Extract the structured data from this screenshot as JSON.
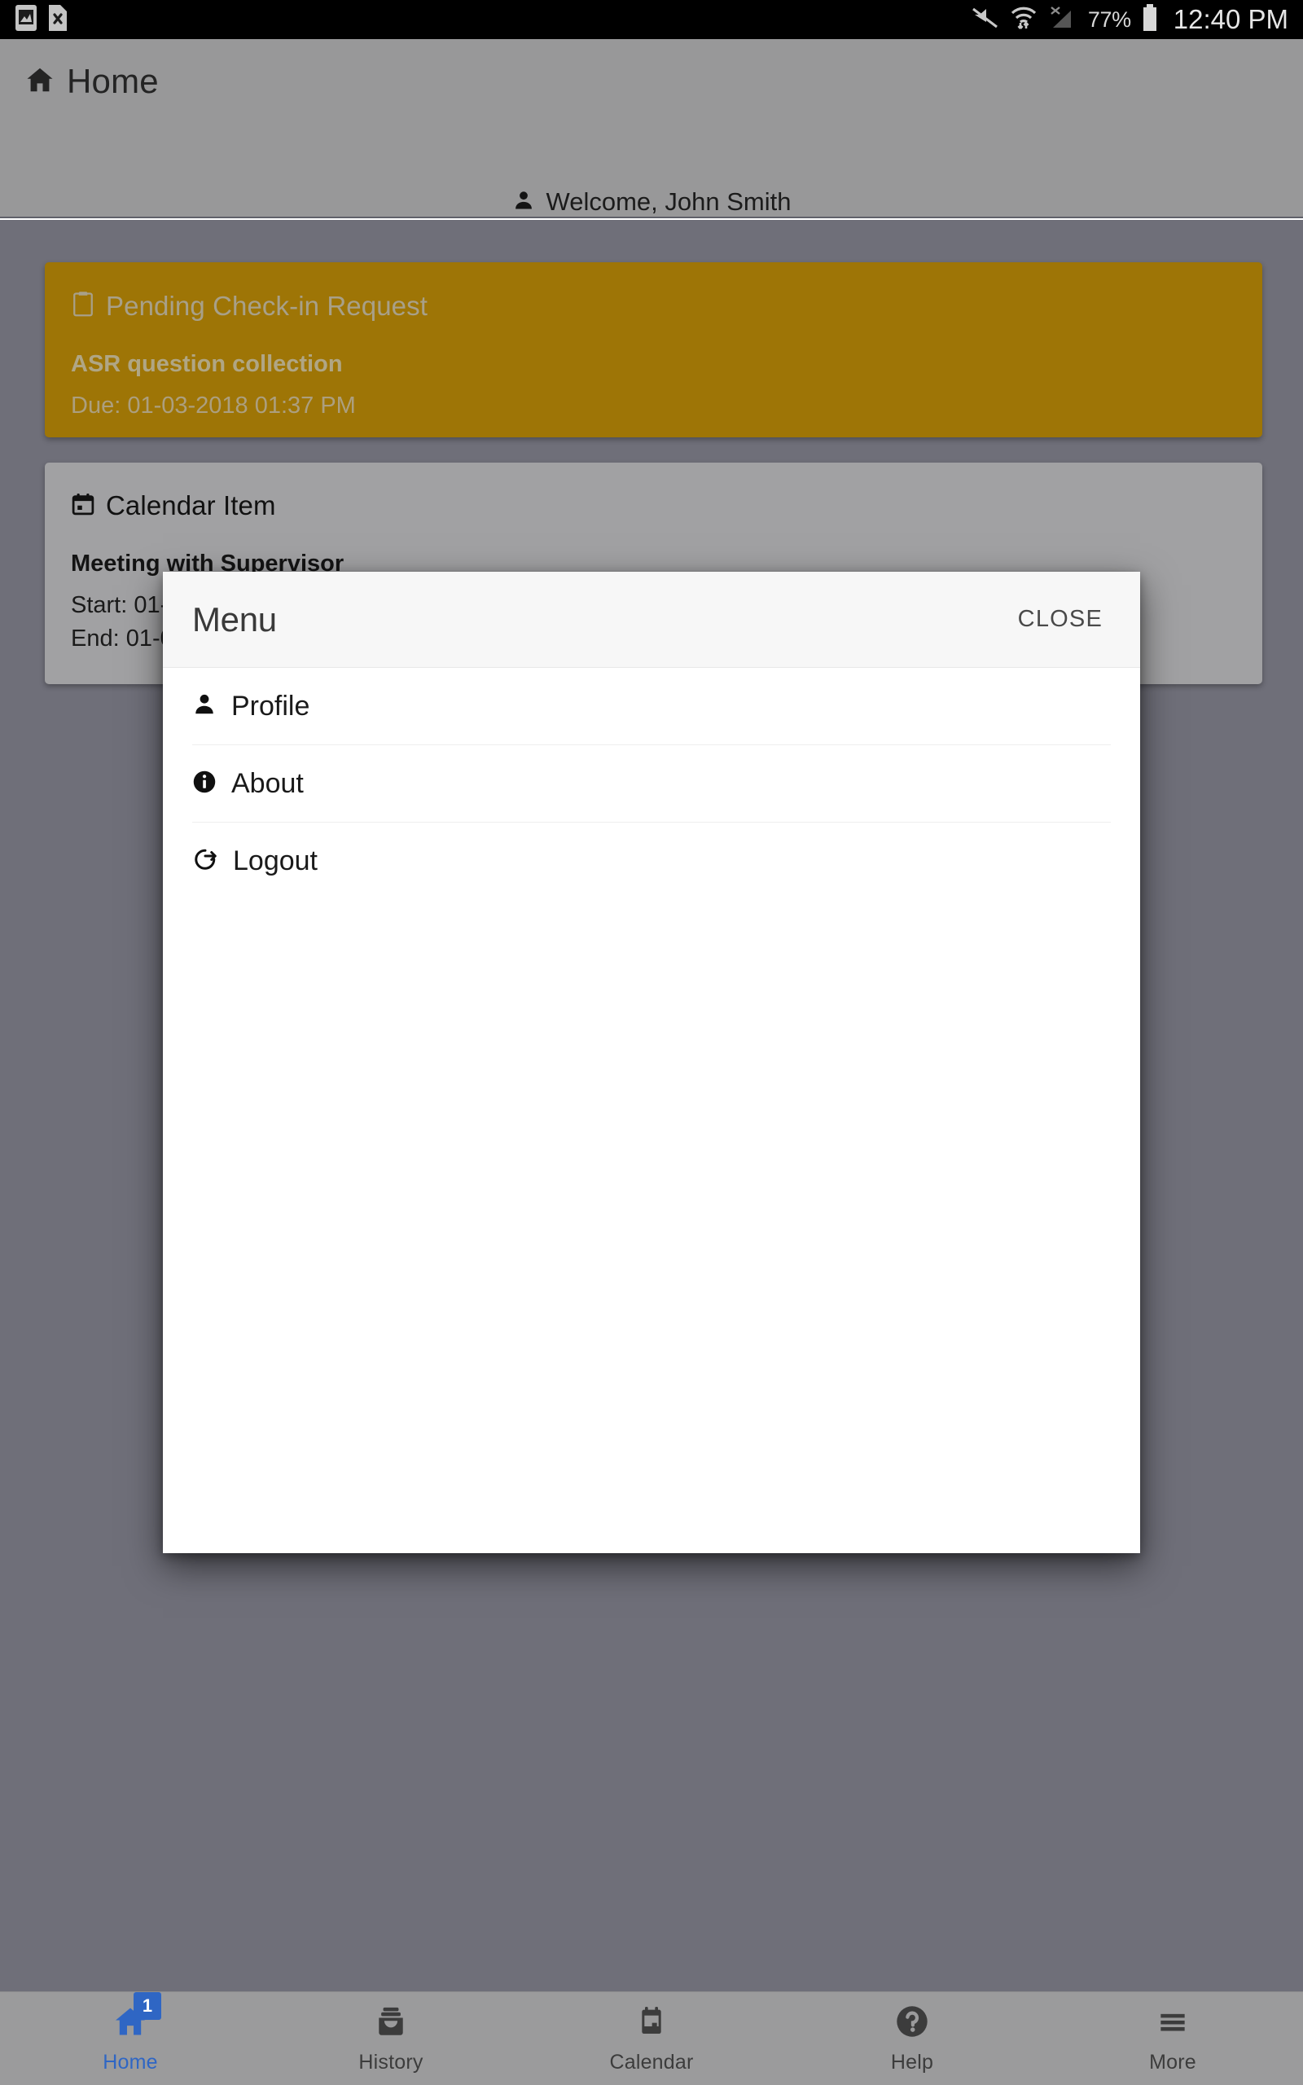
{
  "status_bar": {
    "left_icons": [
      "screenshot-image-icon",
      "document-error-icon"
    ],
    "right_icons": [
      "mute-icon",
      "wifi-icon",
      "cellular-no-service-icon"
    ],
    "battery_percent": "77%",
    "time": "12:40 PM"
  },
  "header": {
    "home_icon": "home-icon",
    "title": "Home",
    "user_icon": "person-icon",
    "welcome": "Welcome, John Smith"
  },
  "cards": {
    "pending": {
      "icon": "clipboard-icon",
      "head_title": "Pending Check-in Request",
      "body_title": "ASR question collection",
      "due": "Due: 01-03-2018 01:37 PM",
      "color": "#9e7506"
    },
    "calendar": {
      "icon": "calendar-icon",
      "head_title": "Calendar Item",
      "body_title": "Meeting with Supervisor",
      "start": "Start: 01-",
      "end": "End: 01-0",
      "color": "#a1a1a3"
    }
  },
  "modal": {
    "title": "Menu",
    "close_label": "CLOSE",
    "items": [
      {
        "icon": "person-icon",
        "label": "Profile"
      },
      {
        "icon": "info-circle-icon",
        "label": "About"
      },
      {
        "icon": "logout-icon",
        "label": "Logout"
      }
    ]
  },
  "bottom_nav": {
    "active_color": "#2f66c4",
    "items": [
      {
        "icon": "home-icon",
        "label": "Home",
        "badge": "1"
      },
      {
        "icon": "archive-icon",
        "label": "History",
        "badge": ""
      },
      {
        "icon": "calendar-icon",
        "label": "Calendar",
        "badge": ""
      },
      {
        "icon": "help-circle-icon",
        "label": "Help",
        "badge": ""
      },
      {
        "icon": "hamburger-icon",
        "label": "More",
        "badge": ""
      }
    ]
  }
}
